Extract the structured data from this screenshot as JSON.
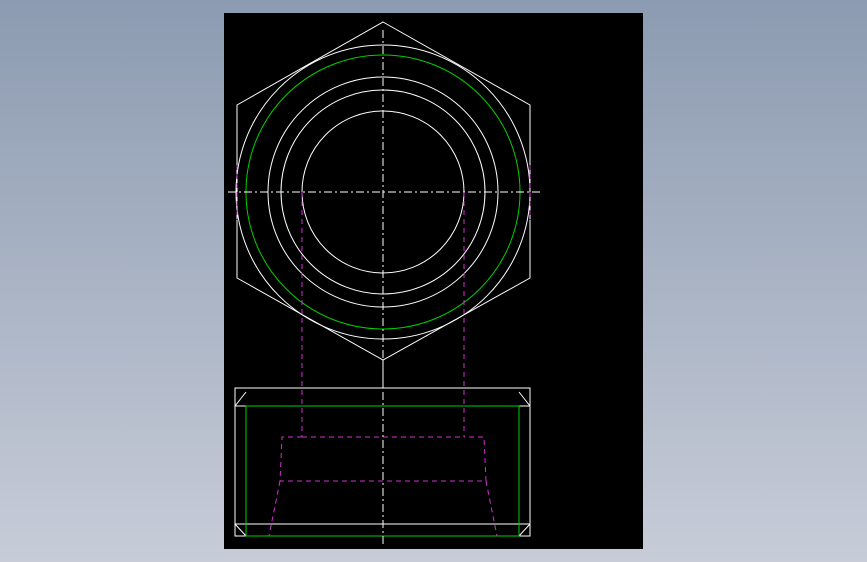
{
  "colors": {
    "background_top": "#8c9bb1",
    "background_bottom": "#c7ccd8",
    "viewport": "#000000",
    "outline": "#ffffff",
    "thread": "#00d000",
    "hidden": "#d030d0",
    "centerline": "#ffffff"
  },
  "views": [
    {
      "name": "top-view",
      "shape": "hexagon",
      "concentric_circles": 5
    },
    {
      "name": "front-view",
      "shape": "section",
      "hidden_lines": true
    }
  ]
}
